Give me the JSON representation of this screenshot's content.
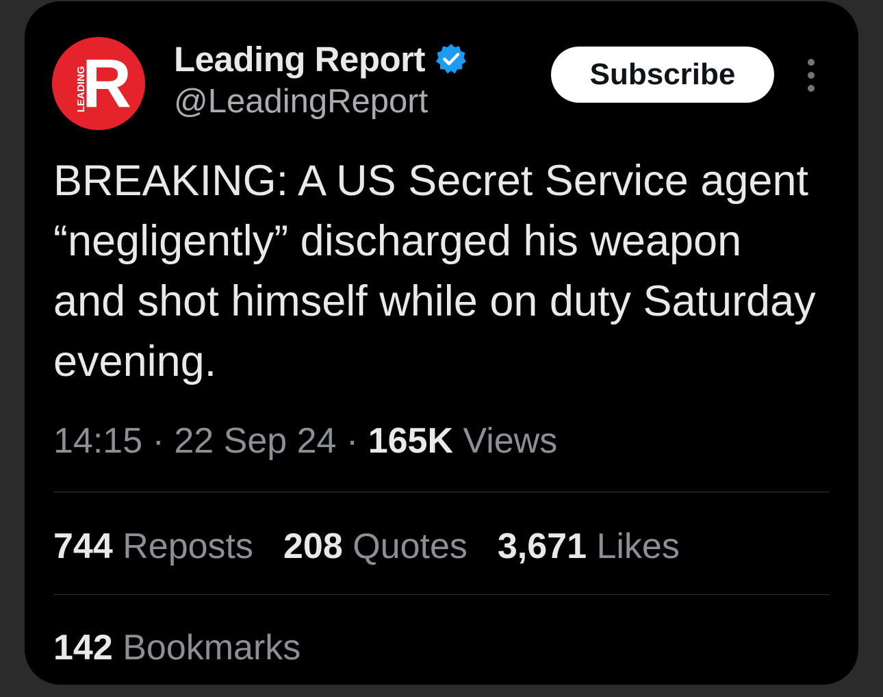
{
  "author": {
    "name": "Leading Report",
    "handle": "@LeadingReport",
    "avatar_letter": "R",
    "avatar_text": "LEADING",
    "verified": true
  },
  "subscribe_label": "Subscribe",
  "tweet": {
    "text": "BREAKING: A US Secret Service agent “negligently” discharged his weapon and shot himself while on duty Saturday evening.",
    "time": "14:15",
    "date": "22 Sep 24",
    "views_count": "165K",
    "views_label": "Views"
  },
  "stats": {
    "reposts": {
      "count": "744",
      "label": "Reposts"
    },
    "quotes": {
      "count": "208",
      "label": "Quotes"
    },
    "likes": {
      "count": "3,671",
      "label": "Likes"
    },
    "bookmarks": {
      "count": "142",
      "label": "Bookmarks"
    }
  },
  "colors": {
    "background": "#000000",
    "verified_blue": "#1d9bf0",
    "avatar_red": "#e4242a"
  }
}
